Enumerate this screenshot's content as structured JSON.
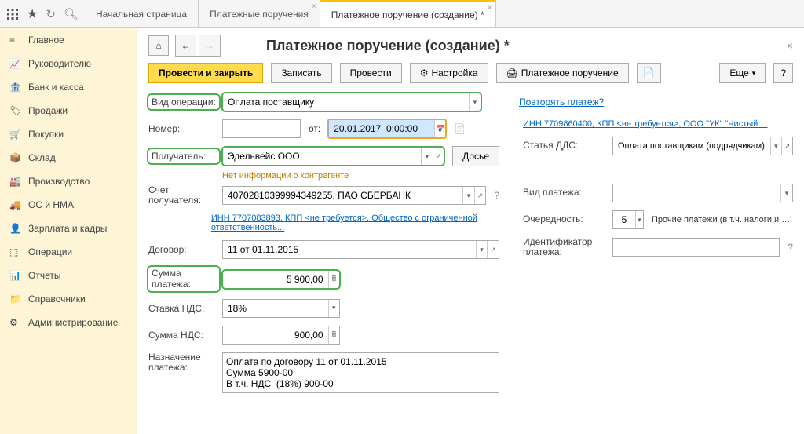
{
  "tabs": {
    "home": "Начальная страница",
    "list": "Платежные поручения",
    "doc": "Платежное поручение (создание) *"
  },
  "sidebar": {
    "items": [
      {
        "label": "Главное"
      },
      {
        "label": "Руководителю"
      },
      {
        "label": "Банк и касса"
      },
      {
        "label": "Продажи"
      },
      {
        "label": "Покупки"
      },
      {
        "label": "Склад"
      },
      {
        "label": "Производство"
      },
      {
        "label": "ОС и НМА"
      },
      {
        "label": "Зарплата и кадры"
      },
      {
        "label": "Операции"
      },
      {
        "label": "Отчеты"
      },
      {
        "label": "Справочники"
      },
      {
        "label": "Администрирование"
      }
    ]
  },
  "title": "Платежное поручение (создание) *",
  "toolbar": {
    "submit": "Провести и закрыть",
    "save": "Записать",
    "post": "Провести",
    "settings": "Настройка",
    "print": "Платежное поручение",
    "more": "Еще"
  },
  "form": {
    "opType_label": "Вид операции:",
    "opType_value": "Оплата поставщику",
    "repeat_link": "Повторять платеж?",
    "number_label": "Номер:",
    "number_value": "",
    "from_label": "от:",
    "date_value": "20.01.2017  0:00:00",
    "inn_link": "ИНН 7709860400, КПП <не требуется>, ООО \"УК\" \"Чистый ...",
    "recipient_label": "Получатель:",
    "recipient_value": "Эдельвейс ООО",
    "dossier": "Досье",
    "dds_label": "Статья ДДС:",
    "dds_value": "Оплата поставщикам (подрядчикам)",
    "warn": "Нет информации о контрагенте",
    "account_label": "Счет получателя:",
    "account_value": "40702810399994349255, ПАО СБЕРБАНК",
    "paytype_label": "Вид платежа:",
    "paytype_value": "",
    "payer_link": "ИНН 7707083893, КПП <не требуется>, Общество с ограниченной ответственность...",
    "priority_label": "Очередность:",
    "priority_value": "5",
    "priority_text": "Прочие платежи (в т.ч. налоги и вз...",
    "contract_label": "Договор:",
    "contract_value": "11 от 01.11.2015",
    "id_label": "Идентификатор платежа:",
    "id_value": "",
    "sum_label": "Сумма платежа:",
    "sum_value": "5 900,00",
    "vat_rate_label": "Ставка НДС:",
    "vat_rate_value": "18%",
    "vat_sum_label": "Сумма НДС:",
    "vat_sum_value": "900,00",
    "purpose_label": "Назначение платежа:",
    "purpose_value": "Оплата по договору 11 от 01.11.2015\nСумма 5900-00\nВ т.ч. НДС  (18%) 900-00"
  }
}
